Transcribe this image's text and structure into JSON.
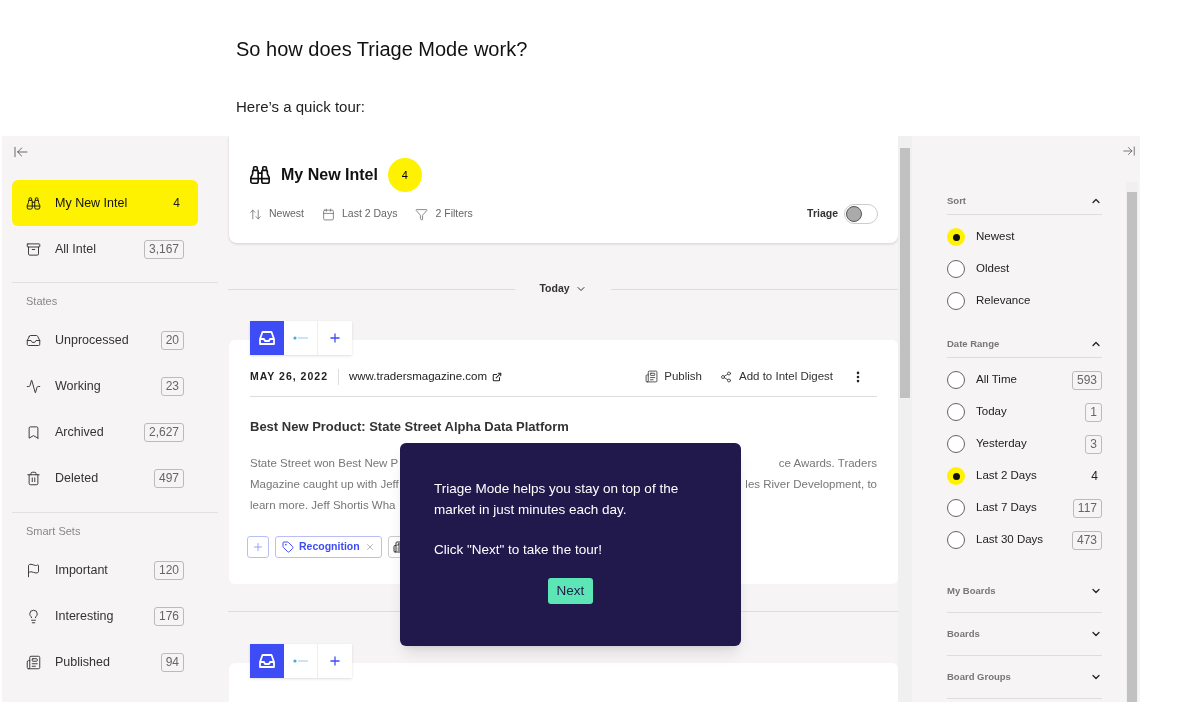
{
  "article": {
    "heading": "So how does Triage Mode work?",
    "intro": "Here’s a quick tour:"
  },
  "sidebar": {
    "sections": [
      {
        "items": [
          {
            "label": "My New Intel",
            "count": "4",
            "selected": true
          },
          {
            "label": "All Intel",
            "count": "3,167",
            "selected": false
          }
        ]
      },
      {
        "title": "States",
        "items": [
          {
            "label": "Unprocessed",
            "count": "20",
            "selected": false
          },
          {
            "label": "Working",
            "count": "23",
            "selected": false
          },
          {
            "label": "Archived",
            "count": "2,627",
            "selected": false
          },
          {
            "label": "Deleted",
            "count": "497",
            "selected": false
          }
        ]
      },
      {
        "title": "Smart Sets",
        "items": [
          {
            "label": "Important",
            "count": "120",
            "selected": false
          },
          {
            "label": "Interesting",
            "count": "176",
            "selected": false
          },
          {
            "label": "Published",
            "count": "94",
            "selected": false
          }
        ]
      }
    ]
  },
  "header": {
    "title": "My New Intel",
    "count": "4",
    "filters": [
      "Newest",
      "Last 2 Days",
      "2 Filters"
    ],
    "toggle": {
      "label": "Triage",
      "on": false
    }
  },
  "group_label": "Today",
  "card": {
    "date": "MAY 26, 2022",
    "source": "www.tradersmagazine.com",
    "actions": [
      "Publish",
      "Add to Intel Digest"
    ],
    "title": "Best New Product: State Street Alpha Data Platform",
    "body_lines": [
      {
        "left": "State Street won Best New P",
        "right": "ce Awards. Traders"
      },
      {
        "left": "Magazine caught up with Jeff",
        "right": "les River Development, to"
      },
      {
        "left": "learn more. Jeff Shortis Wha"
      }
    ],
    "tags": [
      {
        "label": "Recognition"
      }
    ]
  },
  "tour": {
    "paragraphs": [
      "Triage Mode helps you stay on top of the market in just minutes each day.",
      "Click \"Next\" to take the tour!"
    ],
    "button": "Next"
  },
  "filters": {
    "sections": [
      {
        "title": "Sort",
        "expanded": true,
        "options": [
          {
            "label": "Newest",
            "selected": true
          },
          {
            "label": "Oldest",
            "selected": false
          },
          {
            "label": "Relevance",
            "selected": false
          }
        ]
      },
      {
        "title": "Date Range",
        "expanded": true,
        "options": [
          {
            "label": "All Time",
            "count": "593",
            "selected": false
          },
          {
            "label": "Today",
            "count": "1",
            "selected": false
          },
          {
            "label": "Yesterday",
            "count": "3",
            "selected": false
          },
          {
            "label": "Last 2 Days",
            "count": "4",
            "selected": true
          },
          {
            "label": "Last 7 Days",
            "count": "117",
            "selected": false
          },
          {
            "label": "Last 30 Days",
            "count": "473",
            "selected": false
          }
        ]
      },
      {
        "title": "My Boards",
        "expanded": false
      },
      {
        "title": "Boards",
        "expanded": false
      },
      {
        "title": "Board Groups",
        "expanded": false
      }
    ]
  }
}
